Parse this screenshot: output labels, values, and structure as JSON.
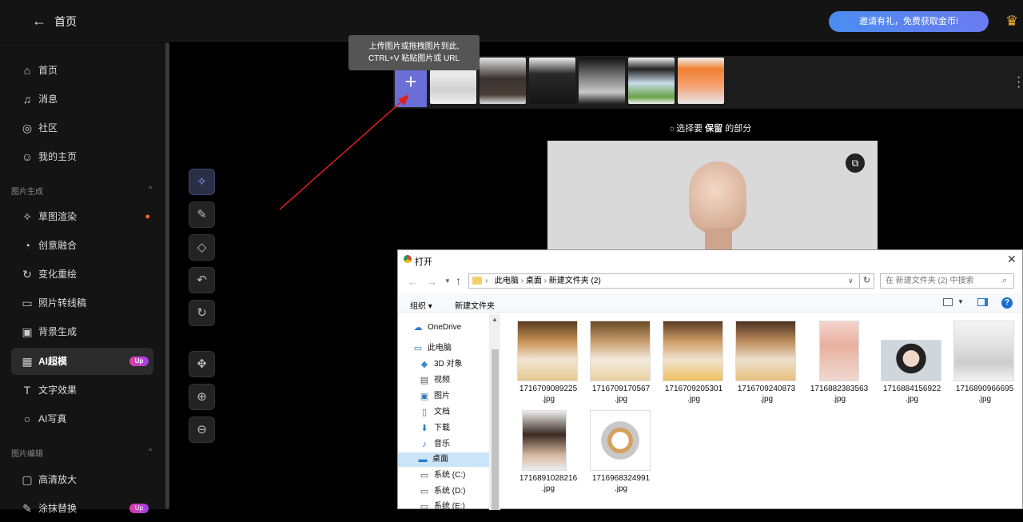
{
  "topbar": {
    "title": "首页",
    "invite": "邀请有礼，免费获取金币!"
  },
  "sidebar": {
    "items": [
      {
        "label": "首页",
        "icon": "home-icon"
      },
      {
        "label": "消息",
        "icon": "bell-icon"
      },
      {
        "label": "社区",
        "icon": "compass-icon"
      },
      {
        "label": "我的主页",
        "icon": "user-icon"
      },
      {
        "label": "草图渲染",
        "icon": "sparkle-icon"
      },
      {
        "label": "创意融合",
        "icon": "blend-icon"
      },
      {
        "label": "变化重绘",
        "icon": "refresh-icon"
      },
      {
        "label": "照片转线稿",
        "icon": "frame-icon"
      },
      {
        "label": "背景生成",
        "icon": "image-icon"
      },
      {
        "label": "AI超模",
        "icon": "model-icon",
        "badge": "Up"
      },
      {
        "label": "文字效果",
        "icon": "text-icon"
      },
      {
        "label": "AI写真",
        "icon": "portrait-icon"
      },
      {
        "label": "高清放大",
        "icon": "hd-icon"
      },
      {
        "label": "涂抹替换",
        "icon": "brush-icon",
        "badge": "Up"
      }
    ],
    "sections": {
      "gen": "图片生成",
      "edit": "图片编辑"
    }
  },
  "tools": [
    "magic-select",
    "brush",
    "eraser",
    "undo",
    "reset",
    "move",
    "zoom-in",
    "zoom-out"
  ],
  "tooltip": {
    "line1": "上传图片或拖拽图片到此,",
    "line2": "CTRL+V 粘贴图片或 URL"
  },
  "hint": {
    "prefix": "选择要",
    "keep": "保留",
    "suffix": "的部分"
  },
  "colors": {
    "accent": "#6a6fd8",
    "invite_from": "#4a8df0",
    "badge": "#e040a0"
  },
  "dialog": {
    "title": "打开",
    "path": [
      "此电脑",
      "桌面",
      "新建文件夹 (2)"
    ],
    "search_placeholder": "在 新建文件夹 (2) 中搜索",
    "organize": "组织",
    "new_folder": "新建文件夹",
    "tree": [
      "OneDrive",
      "此电脑",
      "3D 对象",
      "视频",
      "图片",
      "文档",
      "下载",
      "音乐",
      "桌面",
      "系统 (C:)",
      "系统 (D:)",
      "系统 (E:)"
    ],
    "files": [
      {
        "name1": "1716709089225",
        "name2": ".jpg"
      },
      {
        "name1": "1716709170567",
        "name2": ".jpg"
      },
      {
        "name1": "1716709205301",
        "name2": ".jpg"
      },
      {
        "name1": "1716709240873",
        "name2": ".jpg"
      },
      {
        "name1": "1716882383563",
        "name2": ".jpg"
      },
      {
        "name1": "1716884156922",
        "name2": ".jpg"
      },
      {
        "name1": "1716890966695",
        "name2": ".jpg"
      },
      {
        "name1": "1716891028216",
        "name2": ".jpg"
      },
      {
        "name1": "1716968324991",
        "name2": ".jpg"
      }
    ]
  }
}
